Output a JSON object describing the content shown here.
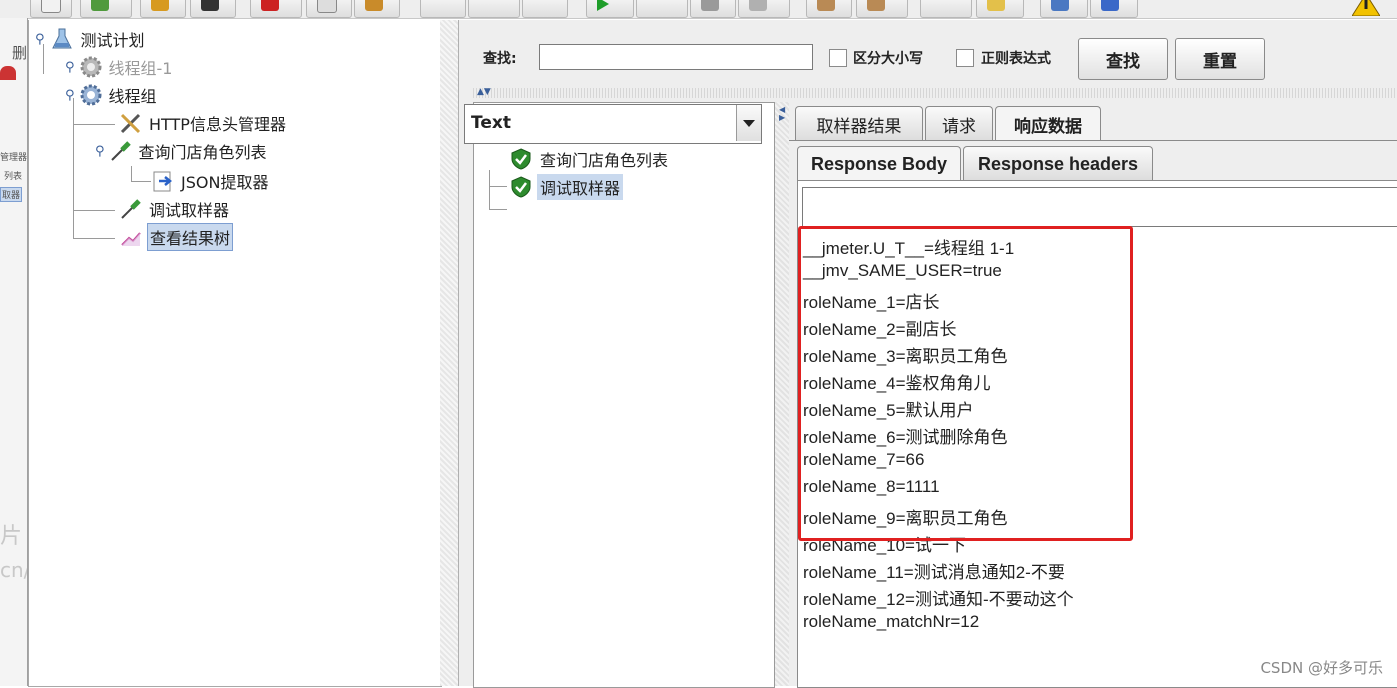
{
  "left_strip": {
    "fragments": [
      "删",
      "管理器",
      "列表",
      "取器",
      "片",
      "cn/"
    ]
  },
  "test_plan_tree": {
    "items": [
      {
        "label": "测试计划",
        "state": "normal"
      },
      {
        "label": "线程组-1",
        "state": "disabled"
      },
      {
        "label": "线程组",
        "state": "normal"
      },
      {
        "label": "HTTP信息头管理器",
        "state": "normal"
      },
      {
        "label": "查询门店角色列表",
        "state": "normal"
      },
      {
        "label": "JSON提取器",
        "state": "normal"
      },
      {
        "label": "调试取样器",
        "state": "normal"
      },
      {
        "label": "查看结果树",
        "state": "selected"
      }
    ]
  },
  "search_bar": {
    "label": "查找:",
    "input_value": "",
    "case_sensitive_label": "区分大小写",
    "regex_label": "正则表达式",
    "find_button": "查找",
    "reset_button": "重置"
  },
  "results_panel": {
    "renderer": "Text",
    "items": [
      {
        "label": "查询门店角色列表",
        "status": "success",
        "selected": false
      },
      {
        "label": "调试取样器",
        "status": "success",
        "selected": true
      }
    ]
  },
  "detail_tabs": [
    {
      "label": "取样器结果",
      "active": false
    },
    {
      "label": "请求",
      "active": false
    },
    {
      "label": "响应数据",
      "active": true
    }
  ],
  "response_subtabs": [
    {
      "label": "Response Body",
      "active": true
    },
    {
      "label": "Response headers",
      "active": false
    }
  ],
  "response_body": {
    "search_value": "",
    "lines": [
      "__jmeter.U_T__=线程组 1-1",
      "__jmv_SAME_USER=true",
      "roleName_1=店长",
      "roleName_2=副店长",
      "roleName_3=离职员工角色",
      "roleName_4=鉴权角角儿",
      "roleName_5=默认用户",
      "roleName_6=测试删除角色",
      "roleName_7=66",
      "roleName_8=1111",
      "roleName_9=离职员工角色",
      "roleName_10=试一下",
      "roleName_11=测试消息通知2-不要",
      "roleName_12=测试通知-不要动这个",
      "roleName_matchNr=12"
    ]
  },
  "watermark": "CSDN @好多可乐",
  "colors": {
    "highlight": "#e02020",
    "selection": "#c9d9ee",
    "success_icon": "#2e8b2e"
  }
}
